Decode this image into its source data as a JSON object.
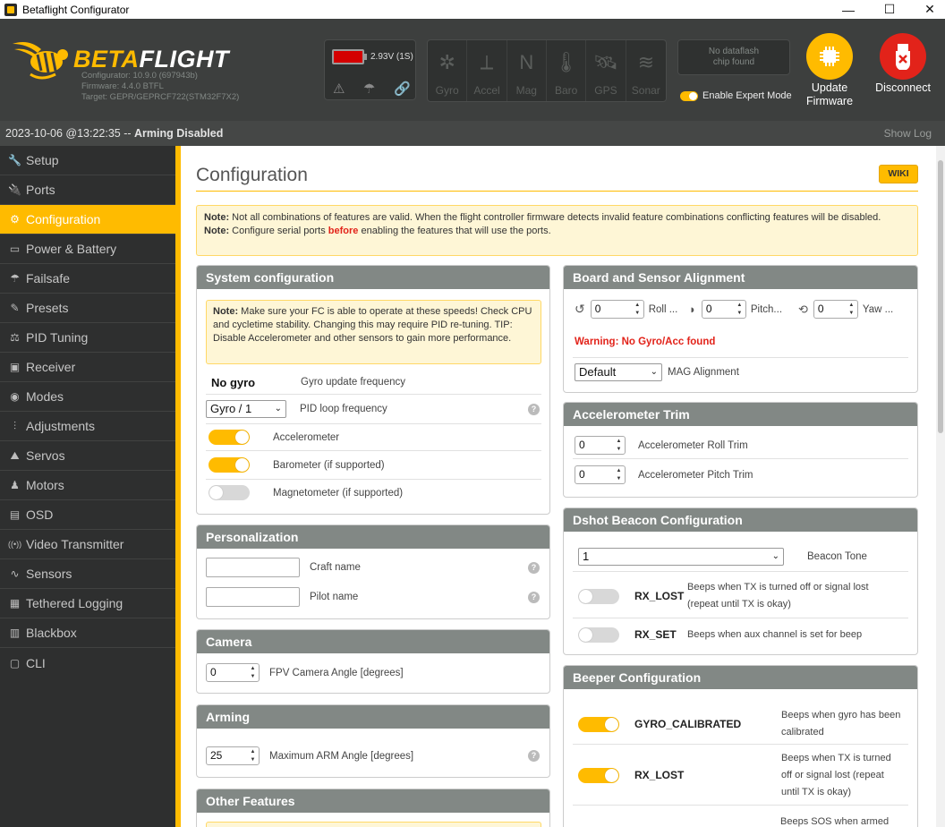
{
  "window": {
    "title": "Betaflight Configurator",
    "minimize": "—",
    "maximize": "☐",
    "close": "✕"
  },
  "header": {
    "logo_beta": "BETA",
    "logo_flight": "FLIGHT",
    "configurator": "Configurator: 10.9.0 (697943b)",
    "firmware": "Firmware: 4.4.0 BTFL",
    "target": "Target: GEPR/GEPRCF722(STM32F7X2)",
    "battery": "2.93V (1S)",
    "sensors": [
      "Gyro",
      "Accel",
      "Mag",
      "Baro",
      "GPS",
      "Sonar"
    ],
    "dataflash_line1": "No dataflash",
    "dataflash_line2": "chip found",
    "expert_mode": "Enable Expert Mode",
    "update_line1": "Update",
    "update_line2": "Firmware",
    "disconnect": "Disconnect"
  },
  "status": {
    "timestamp": "2023-10-06 @13:22:35 -- ",
    "state": "Arming Disabled",
    "show_log": "Show Log"
  },
  "sidebar": {
    "items": [
      {
        "label": "Setup",
        "icon": "🔧"
      },
      {
        "label": "Ports",
        "icon": "🔌"
      },
      {
        "label": "Configuration",
        "icon": "⚙"
      },
      {
        "label": "Power & Battery",
        "icon": "▭"
      },
      {
        "label": "Failsafe",
        "icon": "☂"
      },
      {
        "label": "Presets",
        "icon": "✎"
      },
      {
        "label": "PID Tuning",
        "icon": "⚖"
      },
      {
        "label": "Receiver",
        "icon": "▣"
      },
      {
        "label": "Modes",
        "icon": "◉"
      },
      {
        "label": "Adjustments",
        "icon": "⫶"
      },
      {
        "label": "Servos",
        "icon": "⛰"
      },
      {
        "label": "Motors",
        "icon": "♟"
      },
      {
        "label": "OSD",
        "icon": "▤"
      },
      {
        "label": "Video Transmitter",
        "icon": "((•))"
      },
      {
        "label": "Sensors",
        "icon": "∿"
      },
      {
        "label": "Tethered Logging",
        "icon": "▦"
      },
      {
        "label": "Blackbox",
        "icon": "▥"
      },
      {
        "label": "CLI",
        "icon": "▢"
      }
    ]
  },
  "main": {
    "title": "Configuration",
    "wiki": "WIKI",
    "note_label": "Note:",
    "note_text1": " Not all combinations of features are valid. When the flight controller firmware detects invalid feature combinations conflicting features will be disabled.",
    "note2_pre": " Configure serial ports ",
    "note2_red": "before",
    "note2_post": " enabling the features that will use the ports."
  },
  "system_config": {
    "title": "System configuration",
    "note_label": "Note:",
    "note_text": " Make sure your FC is able to operate at these speeds! Check CPU and cycletime stability. Changing this may require PID re-tuning. TIP: Disable Accelerometer and other sensors to gain more performance.",
    "no_gyro": "No gyro",
    "gyro_freq_label": "Gyro update frequency",
    "pid_loop_value": "Gyro / 1",
    "pid_loop_label": "PID loop frequency",
    "accelerometer": "Accelerometer",
    "barometer": "Barometer (if supported)",
    "magnetometer": "Magnetometer (if supported)"
  },
  "personalization": {
    "title": "Personalization",
    "craft_name": "Craft name",
    "pilot_name": "Pilot name"
  },
  "camera": {
    "title": "Camera",
    "angle_value": "0",
    "angle_label": "FPV Camera Angle [degrees]"
  },
  "arming": {
    "title": "Arming",
    "angle_value": "25",
    "angle_label": "Maximum ARM Angle [degrees]"
  },
  "other_features": {
    "title": "Other Features"
  },
  "alignment": {
    "title": "Board and Sensor Alignment",
    "roll_value": "0",
    "roll_label": "Roll ...",
    "pitch_value": "0",
    "pitch_label": "Pitch...",
    "yaw_value": "0",
    "yaw_label": "Yaw ...",
    "warning": "Warning: No Gyro/Acc found",
    "mag_value": "Default",
    "mag_label": "MAG Alignment"
  },
  "acc_trim": {
    "title": "Accelerometer Trim",
    "roll_value": "0",
    "roll_label": "Accelerometer Roll Trim",
    "pitch_value": "0",
    "pitch_label": "Accelerometer Pitch Trim"
  },
  "dshot": {
    "title": "Dshot Beacon Configuration",
    "tone_value": "1",
    "tone_label": "Beacon Tone",
    "rx_lost": "RX_LOST",
    "rx_lost_desc1": "Beeps when TX is turned off or signal lost",
    "rx_lost_desc2": "(repeat until TX is okay)",
    "rx_set": "RX_SET",
    "rx_set_desc": "Beeps when aux channel is set for beep"
  },
  "beeper": {
    "title": "Beeper Configuration",
    "gyro_cal": "GYRO_CALIBRATED",
    "gyro_cal_desc1": "Beeps when gyro has been",
    "gyro_cal_desc2": "calibrated",
    "rx_lost": "RX_LOST",
    "rx_lost_desc1": "Beeps when TX is turned",
    "rx_lost_desc2": "off or signal lost (repeat",
    "rx_lost_desc3": "until TX is okay)",
    "next_desc": "Beeps SOS when armed"
  },
  "colors": {
    "accent": "#ffbb00",
    "header_bg": "#3d3f3e",
    "sidebar_bg": "#2e2f2f",
    "panel_header": "#828885",
    "warning": "#e2231a",
    "disconnect": "#e2231a"
  }
}
